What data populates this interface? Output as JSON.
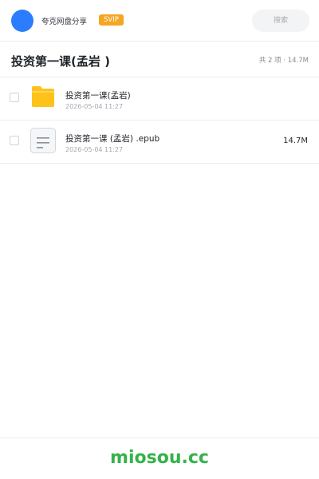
{
  "header": {
    "share_title": "夸克网盘分享",
    "svip_label": "SVIP",
    "search_placeholder": "搜索"
  },
  "folder": {
    "title": "投资第一课(孟岩 )",
    "summary": "共 2 项 · 14.7M"
  },
  "files": [
    {
      "name": "投资第一课(孟岩)",
      "date": "2026-05-04 11:27",
      "size": "",
      "icon": "folder-icon"
    },
    {
      "name": "投资第一课 (孟岩) .epub",
      "date": "2026-05-04 11:27",
      "size": "14.7M",
      "icon": "document-icon"
    }
  ],
  "footer": {
    "brand": "miosou.cc"
  },
  "colors": {
    "accent_blue": "#2b7cff",
    "svip_orange": "#f5a623",
    "folder_yellow": "#ffc21a",
    "brand_green": "#35b24a"
  }
}
